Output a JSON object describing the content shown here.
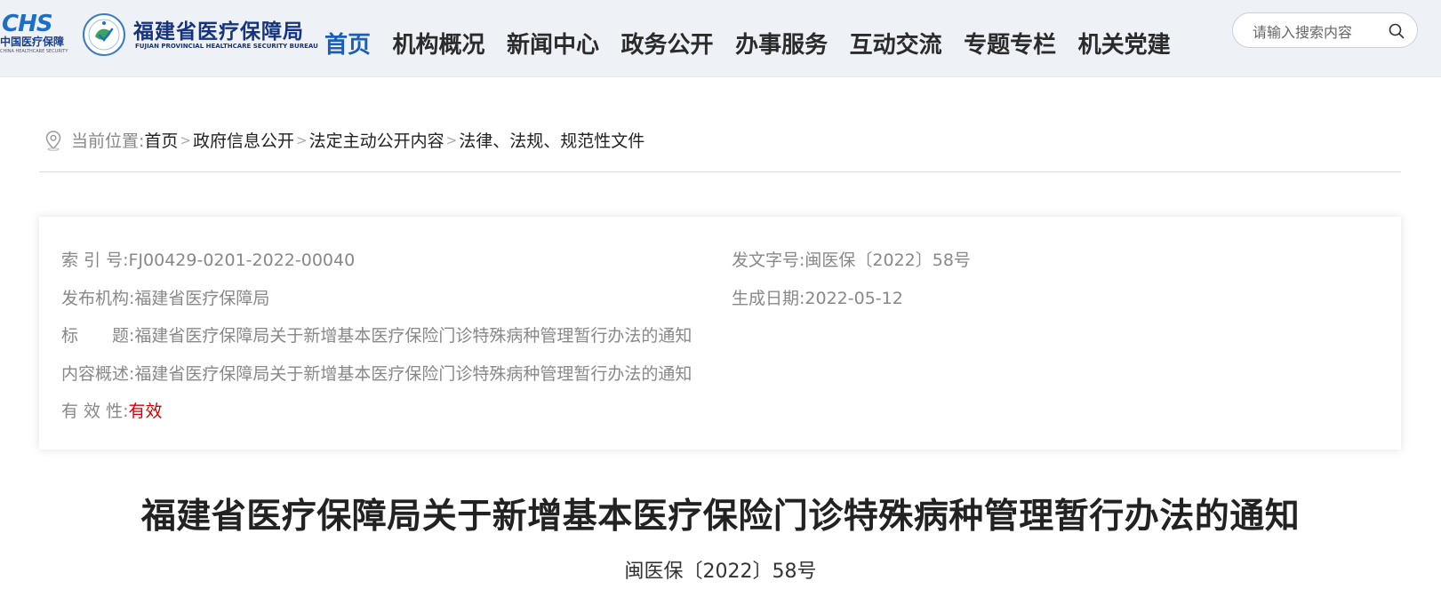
{
  "header": {
    "chs_logo": {
      "mark": "CHS",
      "cn": "中国医疗保障",
      "en": "CHINA HEALTHCARE SECURITY"
    },
    "bureau_name_cn": "福建省医疗保障局",
    "bureau_name_en": "FUJIAN PROVINCIAL HEALTHCARE SECURITY BUREAU",
    "nav": [
      {
        "label": "首页",
        "active": true
      },
      {
        "label": "机构概况"
      },
      {
        "label": "新闻中心"
      },
      {
        "label": "政务公开"
      },
      {
        "label": "办事服务"
      },
      {
        "label": "互动交流"
      },
      {
        "label": "专题专栏"
      },
      {
        "label": "机关党建"
      }
    ],
    "search": {
      "placeholder": "请输入搜索内容",
      "value": ""
    }
  },
  "breadcrumb": {
    "label": "当前位置:",
    "items": [
      "首页",
      "政府信息公开",
      "法定主动公开内容",
      "法律、法规、规范性文件"
    ],
    "separator": ">"
  },
  "info": {
    "index_label": "索 引 号:",
    "index_value": "FJ00429-0201-2022-00040",
    "docno_label": "发文字号:",
    "docno_value": "闽医保〔2022〕58号",
    "publisher_label": "发布机构:",
    "publisher_value": "福建省医疗保障局",
    "date_label": "生成日期:",
    "date_value": "2022-05-12",
    "title_label": "标　　题:",
    "title_value": "福建省医疗保障局关于新增基本医疗保险门诊特殊病种管理暂行办法的通知",
    "summary_label": "内容概述:",
    "summary_value": "福建省医疗保障局关于新增基本医疗保险门诊特殊病种管理暂行办法的通知",
    "validity_label": "有 效 性:",
    "validity_value": "有效"
  },
  "document": {
    "title": "福建省医疗保障局关于新增基本医疗保险门诊特殊病种管理暂行办法的通知",
    "number": "闽医保〔2022〕58号"
  },
  "colors": {
    "brand": "#16347e",
    "active_nav": "#1a5fb4",
    "valid": "#d40000"
  }
}
